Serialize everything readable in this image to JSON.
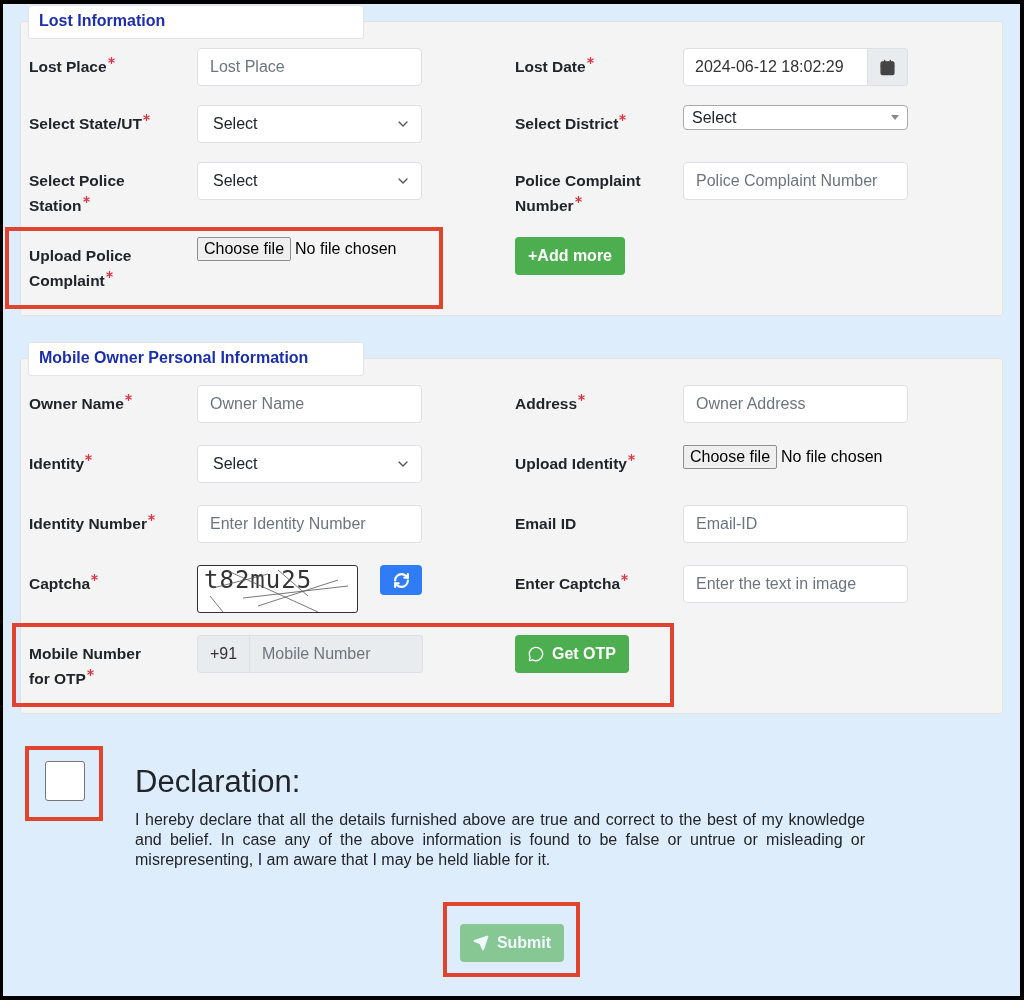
{
  "sections": [
    {
      "title": "Lost Information",
      "rows": [
        {
          "highlighted": false,
          "cells": [
            {
              "label": "Lost Place",
              "required": true,
              "highlighted": false,
              "control": {
                "kind": "text",
                "placeholder": "Lost Place"
              }
            },
            {
              "label": "Lost Date",
              "required": true,
              "highlighted": false,
              "control": {
                "kind": "date",
                "value": "2024-06-12 18:02:29"
              }
            }
          ]
        },
        {
          "highlighted": false,
          "cells": [
            {
              "label": "Select State/UT",
              "required": true,
              "highlighted": false,
              "control": {
                "kind": "select",
                "value": "Select"
              }
            },
            {
              "label": "Select District",
              "required": true,
              "highlighted": false,
              "control": {
                "kind": "combo",
                "value": "Select"
              }
            }
          ]
        },
        {
          "highlighted": false,
          "cells": [
            {
              "label": "Select Police Station",
              "required": true,
              "highlighted": false,
              "control": {
                "kind": "select",
                "value": "Select"
              }
            },
            {
              "label": "Police Complaint Number",
              "required": true,
              "highlighted": false,
              "control": {
                "kind": "text",
                "placeholder": "Police Complaint Number"
              }
            }
          ]
        },
        {
          "highlighted": false,
          "cells": [
            {
              "label": "Upload Police Complaint",
              "required": true,
              "highlighted": true,
              "control": {
                "kind": "file",
                "button": "Choose file",
                "status": "No file chosen"
              }
            },
            {
              "highlighted": false,
              "control": {
                "kind": "add-button",
                "label": "+Add more"
              }
            }
          ]
        }
      ]
    },
    {
      "title": "Mobile Owner Personal Information",
      "rows": [
        {
          "highlighted": false,
          "cells": [
            {
              "label": "Owner Name",
              "required": true,
              "highlighted": false,
              "control": {
                "kind": "text",
                "placeholder": "Owner Name"
              }
            },
            {
              "label": "Address",
              "required": true,
              "highlighted": false,
              "control": {
                "kind": "text",
                "placeholder": "Owner Address"
              }
            }
          ]
        },
        {
          "highlighted": false,
          "cells": [
            {
              "label": "Identity",
              "required": true,
              "highlighted": false,
              "control": {
                "kind": "select",
                "value": "Select"
              }
            },
            {
              "label": "Upload Identity",
              "required": true,
              "highlighted": false,
              "control": {
                "kind": "file",
                "button": "Choose file",
                "status": "No file chosen"
              }
            }
          ]
        },
        {
          "highlighted": false,
          "cells": [
            {
              "label": "Identity Number",
              "required": true,
              "highlighted": false,
              "control": {
                "kind": "text",
                "placeholder": "Enter Identity Number"
              }
            },
            {
              "label": "Email ID",
              "required": false,
              "highlighted": false,
              "control": {
                "kind": "text",
                "placeholder": "Email-ID"
              }
            }
          ]
        },
        {
          "highlighted": false,
          "cells": [
            {
              "label": "Captcha",
              "required": true,
              "highlighted": false,
              "control": {
                "kind": "captcha",
                "value": "t82mu25"
              }
            },
            {
              "label": "Enter Captcha",
              "required": true,
              "highlighted": false,
              "control": {
                "kind": "text",
                "placeholder": "Enter the text in image"
              }
            }
          ]
        },
        {
          "highlighted": true,
          "cells": [
            {
              "label": "Mobile Number for OTP",
              "required": true,
              "highlighted": false,
              "control": {
                "kind": "phone",
                "prefix": "+91",
                "placeholder": "Mobile Number"
              }
            },
            {
              "highlighted": false,
              "control": {
                "kind": "otp-button",
                "label": "Get OTP"
              }
            }
          ]
        }
      ]
    }
  ],
  "declaration": {
    "checked": false,
    "highlighted": true,
    "title": "Declaration:",
    "text": "I hereby declare that all the details furnished above are true and correct to the best of my knowledge and belief. In case any of the above information is found to be false or untrue or misleading or misrepresenting, I am aware that I may be held liable for it."
  },
  "submit": {
    "label": "Submit",
    "disabled": true,
    "highlighted": true
  }
}
